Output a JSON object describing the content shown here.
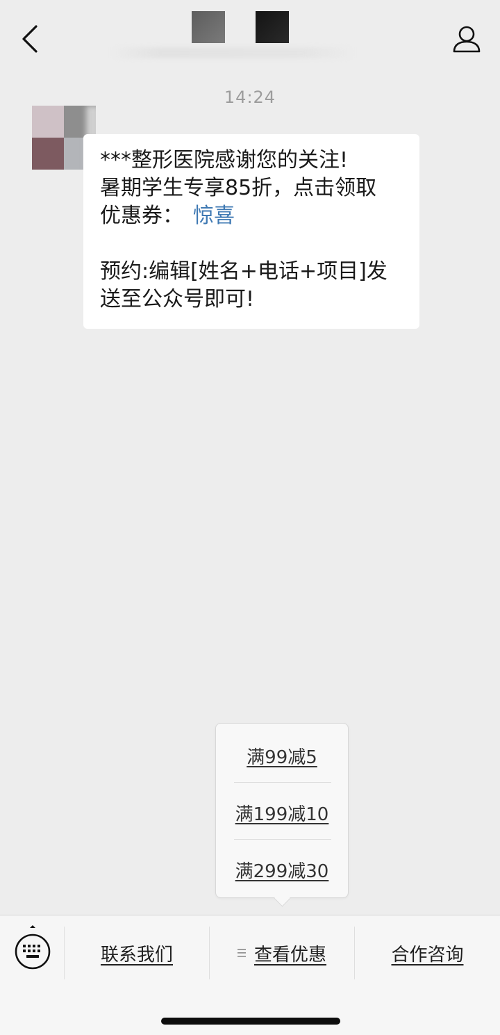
{
  "header": {
    "back_icon": "chevron-left-icon",
    "profile_icon": "person-icon"
  },
  "chat": {
    "timestamp": "14:24",
    "message": {
      "line1": "***整形医院感谢您的关注!",
      "line2": "暑期学生专享85折，点击领取",
      "line3_prefix": "优惠券：",
      "link_text": "惊喜",
      "line4": "预约:编辑[姓名+电话+项目]发",
      "line5": "送至公众号即可!"
    },
    "link_color": "#3f79b3"
  },
  "popup_menu": {
    "items": [
      {
        "label": "满99减5"
      },
      {
        "label": "满199减10"
      },
      {
        "label": "满299减30"
      }
    ]
  },
  "bottom_menu": {
    "keyboard_icon": "keyboard-icon",
    "items": [
      {
        "label": "联系我们"
      },
      {
        "label": "查看优惠"
      },
      {
        "label": "合作咨询"
      }
    ]
  }
}
